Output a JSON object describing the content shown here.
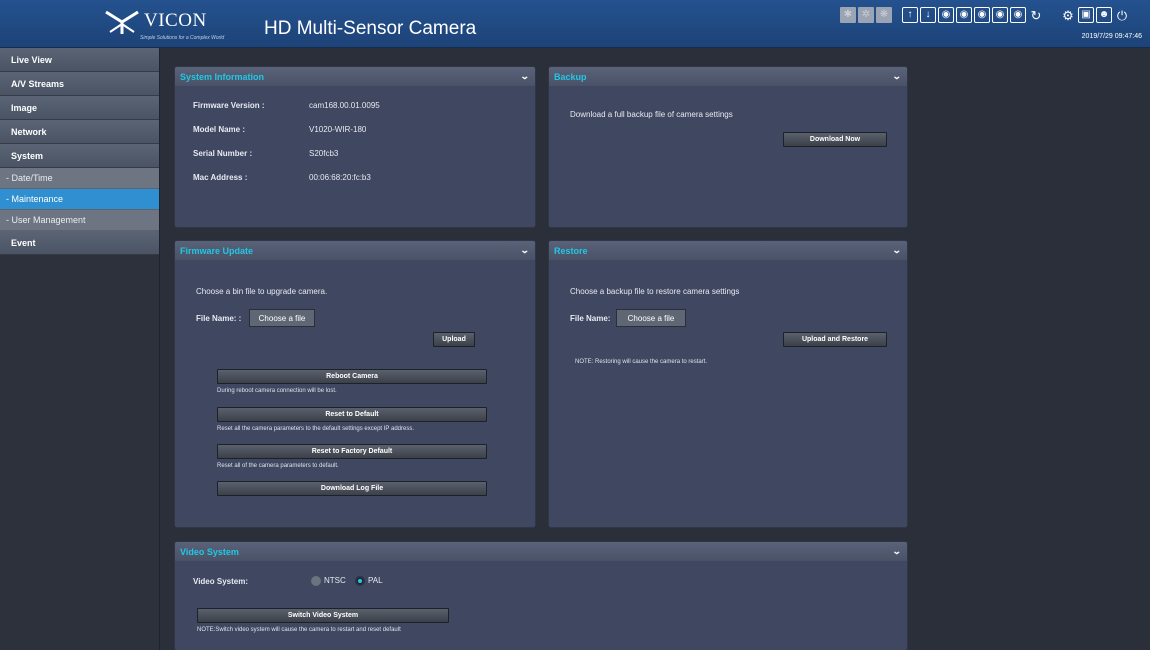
{
  "header": {
    "logo_text": "VICON",
    "logo_tagline": "Simple Solutions for a Complex World",
    "title": "HD Multi-Sensor Camera",
    "timestamp": "2019/7/29 09:47:46"
  },
  "toolbar_icons": [
    "wiper-icon",
    "defog-icon",
    "heater-icon",
    "snapshot-icon",
    "record-icon",
    "sensor-1-icon",
    "sensor-2-icon",
    "sensor-3-icon",
    "sensor-4-icon",
    "sensor-5-icon",
    "refresh-icon",
    "settings-icon",
    "fullscreen-icon",
    "user-icon",
    "power-icon"
  ],
  "sidebar": {
    "items": [
      {
        "label": "Live View"
      },
      {
        "label": "A/V Streams"
      },
      {
        "label": "Image"
      },
      {
        "label": "Network"
      },
      {
        "label": "System"
      },
      {
        "label": "- Date/Time"
      },
      {
        "label": "- Maintenance"
      },
      {
        "label": "- User Management"
      },
      {
        "label": "Event"
      }
    ]
  },
  "system_info": {
    "title": "System Information",
    "rows": [
      {
        "label": "Firmware Version :",
        "value": "cam168.00.01.0095"
      },
      {
        "label": "Model Name :",
        "value": "V1020-WIR-180"
      },
      {
        "label": "Serial Number :",
        "value": "S20fcb3"
      },
      {
        "label": "Mac Address :",
        "value": "00:06:68:20:fc:b3"
      }
    ]
  },
  "backup": {
    "title": "Backup",
    "description": "Download a full backup file of camera settings",
    "button": "Download Now"
  },
  "firmware": {
    "title": "Firmware Update",
    "description": "Choose a bin file to upgrade camera.",
    "file_label": "File Name: :",
    "choose_label": "Choose a file",
    "upload_label": "Upload",
    "reboot_label": "Reboot Camera",
    "reboot_note": "During reboot camera connection will be lost.",
    "reset_label": "Reset to Default",
    "reset_note": "Reset all the camera parameters to the default settings except IP address.",
    "factory_label": "Reset to Factory Default",
    "factory_note": "Reset all of the camera parameters to default.",
    "log_label": "Download Log File"
  },
  "restore": {
    "title": "Restore",
    "description": "Choose a backup file to restore camera settings",
    "file_label": "File Name:",
    "choose_label": "Choose a file",
    "button": "Upload and Restore",
    "note": "NOTE: Restoring will cause the camera to restart."
  },
  "video": {
    "title": "Video System",
    "label": "Video System:",
    "option_ntsc": "NTSC",
    "option_pal": "PAL",
    "selected": "PAL",
    "button": "Switch Video System",
    "note": "NOTE:Switch video system will cause the camera to restart and reset default"
  },
  "colors": {
    "header_bg": "#24528f",
    "panel_title": "#21c7e5",
    "active_nav": "#2f8fd0"
  }
}
